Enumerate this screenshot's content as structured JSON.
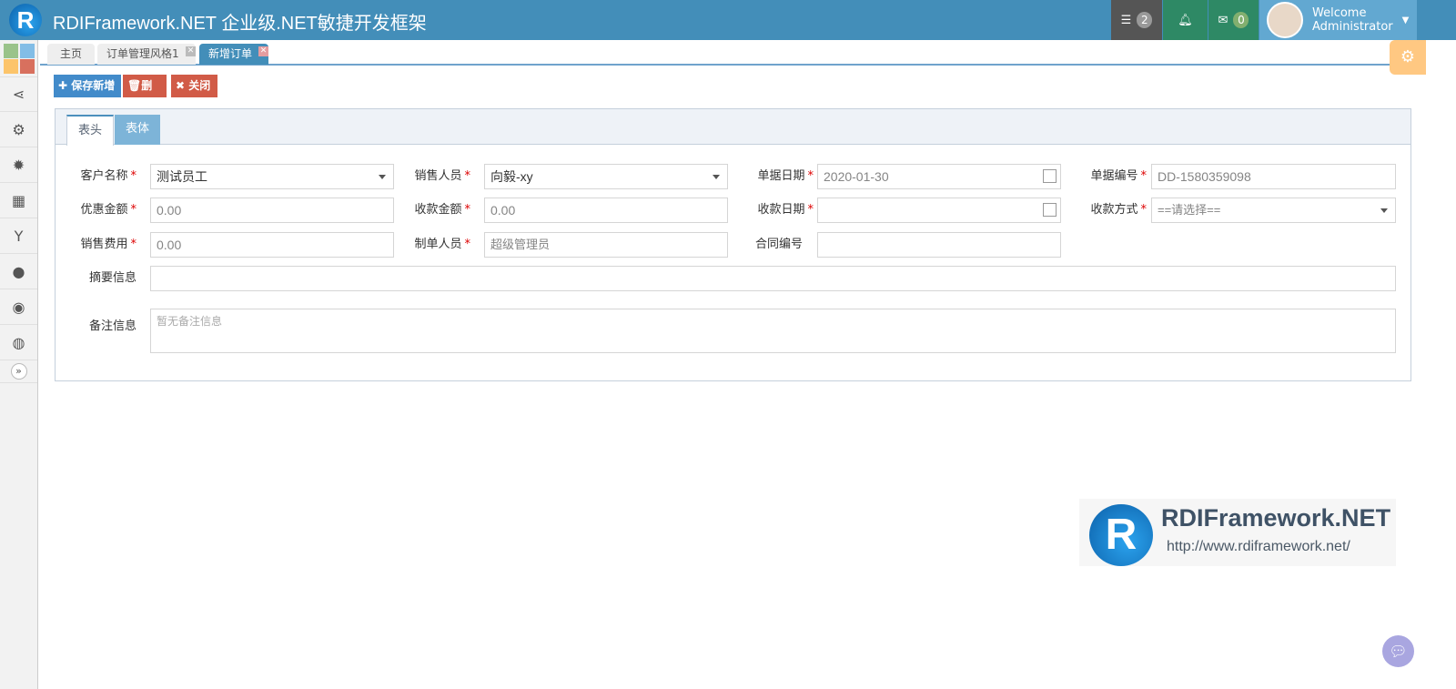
{
  "header": {
    "logo_letter": "R",
    "title": "RDIFramework.NET 企业级.NET敏捷开发框架",
    "tasks_count": "2",
    "messages_count": "0",
    "welcome": "Welcome",
    "user": "Administrator"
  },
  "tabs": [
    {
      "label": "主页"
    },
    {
      "label": "订单管理风格1"
    },
    {
      "label": "新增订单"
    }
  ],
  "toolbar": {
    "save": "保存新增",
    "delete": "删除",
    "close": "关闭"
  },
  "panel_tabs": [
    {
      "label": "表头"
    },
    {
      "label": "表体"
    }
  ],
  "form": {
    "customer": {
      "label": "客户名称",
      "value": "测试员工"
    },
    "salesperson": {
      "label": "销售人员",
      "value": "向毅-xy"
    },
    "doc_date": {
      "label": "单据日期",
      "value": "2020-01-30"
    },
    "doc_no": {
      "label": "单据编号",
      "value": "DD-1580359098"
    },
    "discount": {
      "label": "优惠金额",
      "value": "0.00"
    },
    "received": {
      "label": "收款金额",
      "value": "0.00"
    },
    "receive_date": {
      "label": "收款日期",
      "value": ""
    },
    "pay_method": {
      "label": "收款方式",
      "value": "==请选择=="
    },
    "sales_cost": {
      "label": "销售费用",
      "value": "0.00"
    },
    "creator": {
      "label": "制单人员",
      "value": "超级管理员"
    },
    "contract_no": {
      "label": "合同编号",
      "value": ""
    },
    "summary": {
      "label": "摘要信息",
      "value": ""
    },
    "remark": {
      "label": "备注信息",
      "placeholder": "暂无备注信息"
    }
  },
  "watermark": {
    "name": "RDIFramework.NET",
    "url": "http://www.rdiframework.net/"
  },
  "colors": {
    "header": "#438eb9",
    "danger": "#d15b47",
    "primary": "#428bca"
  }
}
